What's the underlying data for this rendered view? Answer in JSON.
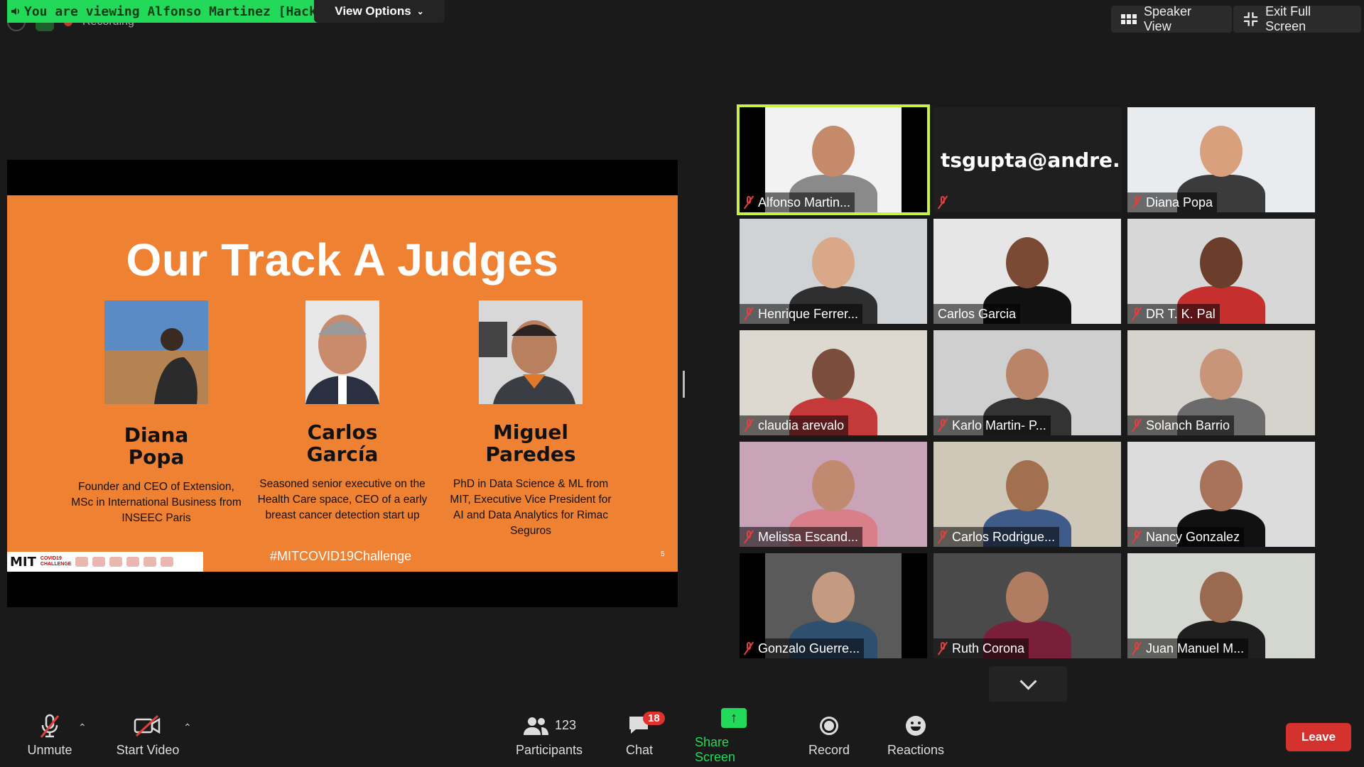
{
  "top": {
    "viewing_banner": "You are viewing Alfonso Martinez [Hack Team]",
    "view_options": "View Options",
    "recording": "Recording",
    "speaker_view": "Speaker View",
    "exit_full_screen": "Exit Full Screen"
  },
  "slide": {
    "title": "Our Track A Judges",
    "judges": [
      {
        "name_line1": "Diana",
        "name_line2": "Popa",
        "desc": "Founder and CEO of Extension, MSc in International Business from INSEEC Paris"
      },
      {
        "name_line1": "Carlos",
        "name_line2": "García",
        "desc": "Seasoned senior executive on the Health Care space, CEO of a early breast cancer detection start up"
      },
      {
        "name_line1": "Miguel",
        "name_line2": "Paredes",
        "desc": "PhD in Data Science & ML from MIT, Executive Vice President for AI and Data Analytics for Rimac Seguros"
      }
    ],
    "hashtag": "#MITCOVID19Challenge",
    "page_number": "5",
    "logo_text": "MIT",
    "logo_sub1": "COVID19",
    "logo_sub2": "CHALLENGE"
  },
  "participants_grid": [
    {
      "name": "Alfonso Martin...",
      "muted": true,
      "active": true
    },
    {
      "name": "tsgupta@andre...",
      "muted": true,
      "text_only": true
    },
    {
      "name": "Diana Popa",
      "muted": true
    },
    {
      "name": "Henrique Ferrer...",
      "muted": true
    },
    {
      "name": "Carlos Garcia",
      "muted": false
    },
    {
      "name": "DR T. K. Pal",
      "muted": true
    },
    {
      "name": "claudia arevalo",
      "muted": true
    },
    {
      "name": "Karlo Martin- P...",
      "muted": true
    },
    {
      "name": "Solanch Barrio",
      "muted": true
    },
    {
      "name": "Melissa Escand...",
      "muted": true
    },
    {
      "name": "Carlos Rodrigue...",
      "muted": true
    },
    {
      "name": "Nancy Gonzalez",
      "muted": true
    },
    {
      "name": "Gonzalo Guerre...",
      "muted": true
    },
    {
      "name": "Ruth Corona",
      "muted": true
    },
    {
      "name": "Juan Manuel M...",
      "muted": true
    }
  ],
  "toolbar": {
    "unmute": "Unmute",
    "start_video": "Start Video",
    "participants": "Participants",
    "participants_count": "123",
    "chat": "Chat",
    "chat_badge": "18",
    "share_screen": "Share Screen",
    "record": "Record",
    "reactions": "Reactions",
    "leave": "Leave"
  },
  "colors": {
    "banner_green": "#23d959",
    "slide_orange": "#ef8133",
    "active_speaker_outline": "#c8f046",
    "leave_red": "#d4322d",
    "muted_red": "#e04040"
  }
}
